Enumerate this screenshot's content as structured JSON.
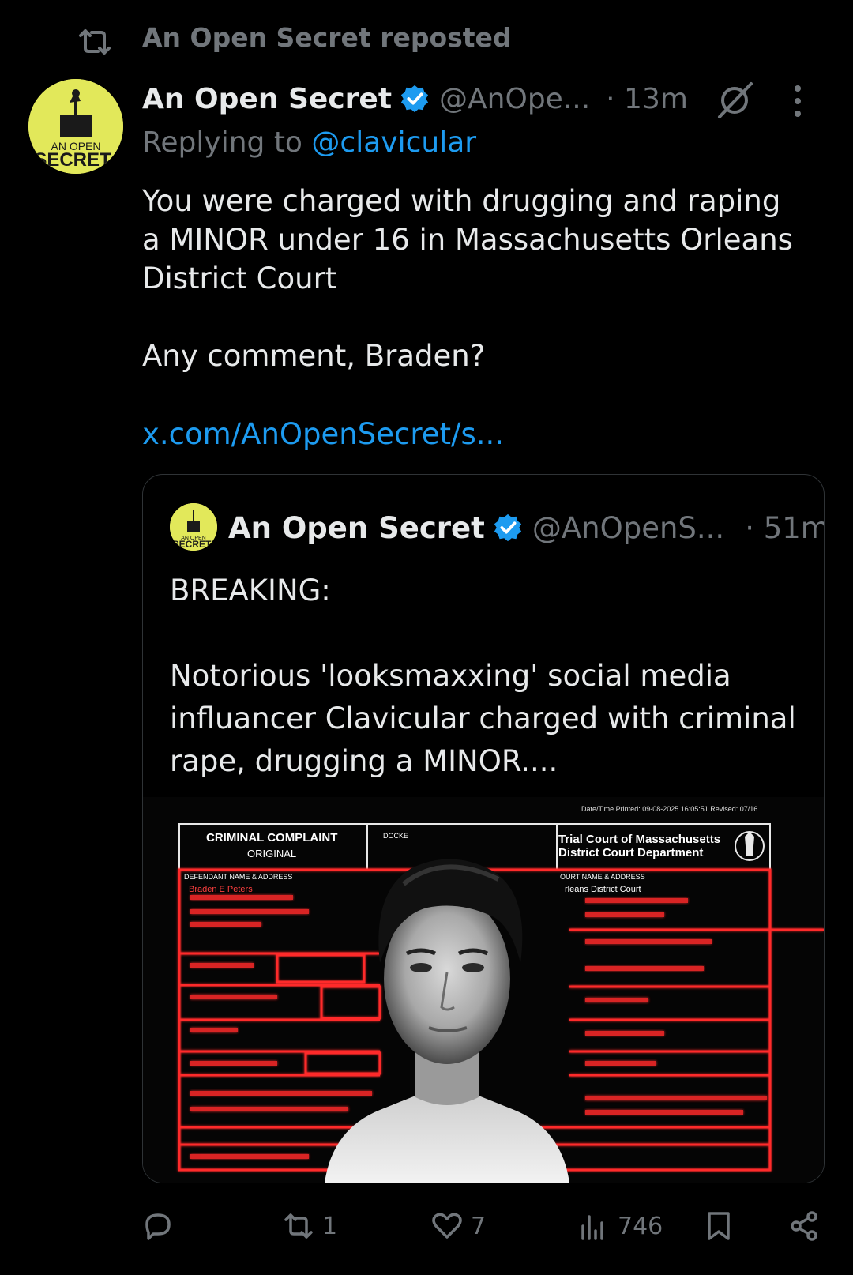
{
  "repost": {
    "label": "An Open Secret reposted"
  },
  "post": {
    "author_name": "An Open Secret",
    "handle": "@AnOpe...",
    "time": "· 13m",
    "replying_prefix": "Replying to",
    "replying_to": "@clavicular",
    "text_p1": "You were charged with drugging and raping a MINOR under 16 in Massachusetts Orleans District Court",
    "text_p2": "Any comment, Braden?",
    "link": "x.com/AnOpenSecret/s..."
  },
  "quote": {
    "author_name": "An Open Secret",
    "handle": "@AnOpenS...",
    "time": "· 51m",
    "text_p1": "BREAKING:",
    "text_p2": "Notorious 'looksmaxxing' social media influancer Clavicular charged with criminal rape, drugging a MINOR....",
    "media": {
      "printed": "Date/Time Printed: 09-08-2025 16:05:51   Revised: 07/16",
      "form_title": "CRIMINAL COMPLAINT",
      "form_subtitle": "ORIGINAL",
      "docket": "DOCKE",
      "court_line1": "Trial Court of Massachusetts",
      "court_line2": "District Court Department",
      "defendant_label": "DEFENDANT NAME & ADDRESS",
      "defendant_name": "Braden E Peters",
      "court_label": "OURT NAME & ADDRESS",
      "court_name": "rleans District Court"
    },
    "avatar_text": "AN OPEN SECRET"
  },
  "actions": {
    "reply_count": "",
    "repost_count": "1",
    "like_count": "7",
    "views_count": "746"
  },
  "colors": {
    "background": "#000000",
    "text": "#e7e9ea",
    "muted": "#71767b",
    "accent": "#1d9bf0",
    "avatar_bg": "#e2e85a",
    "document_red": "#ff2a2a"
  },
  "icons": [
    "repost-icon",
    "verified-badge-icon",
    "grok-icon",
    "more-icon",
    "reply-icon",
    "like-icon",
    "views-icon",
    "bookmark-icon",
    "share-icon"
  ]
}
